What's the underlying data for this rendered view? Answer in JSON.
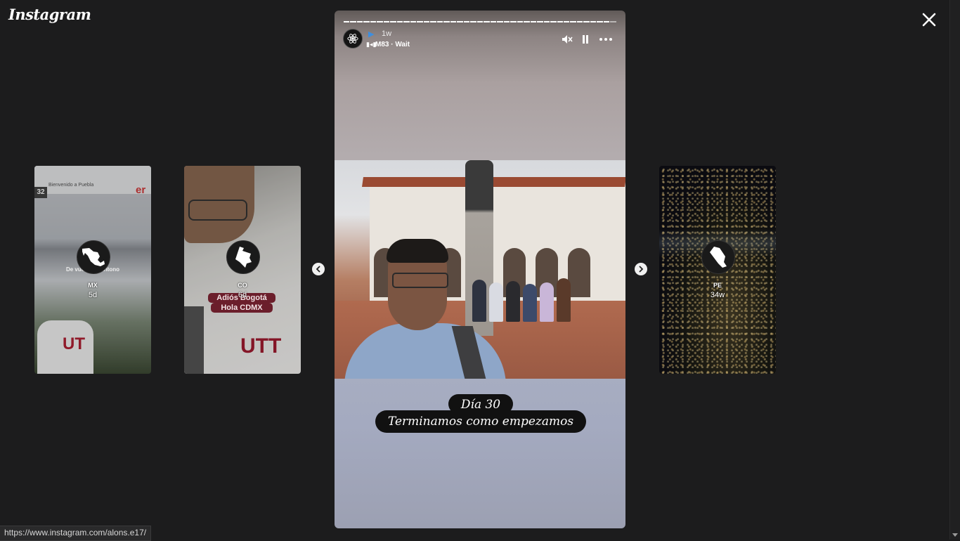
{
  "app": {
    "logo": "Instagram"
  },
  "side_stories": [
    {
      "username": "MX",
      "time": "5d",
      "caption": "De vuelta ...pantono",
      "sign_text": "Bienvenido a Puebla",
      "sign_number": "32",
      "sign_brand": "er",
      "shirt_text": "UT"
    },
    {
      "username": "CO",
      "time": "6d",
      "sticker_line1": "Adiós Bogotá",
      "sticker_line2": "Hola CDMX",
      "shirt_text": "UTT"
    },
    {
      "username": "PE",
      "time": "34w"
    }
  ],
  "story": {
    "time": "1w",
    "flag": "▶",
    "music": "M83 · Wait",
    "caption_line1": "Día 30",
    "caption_line2": "Terminamos como empezamos",
    "progress_total": 41,
    "progress_current": 40
  },
  "status_bar": {
    "url": "https://www.instagram.com/alons.e17/"
  },
  "colors": {
    "background": "#1c1c1d",
    "caption_bg": "#111111",
    "sticker": "#6b1e2b"
  }
}
